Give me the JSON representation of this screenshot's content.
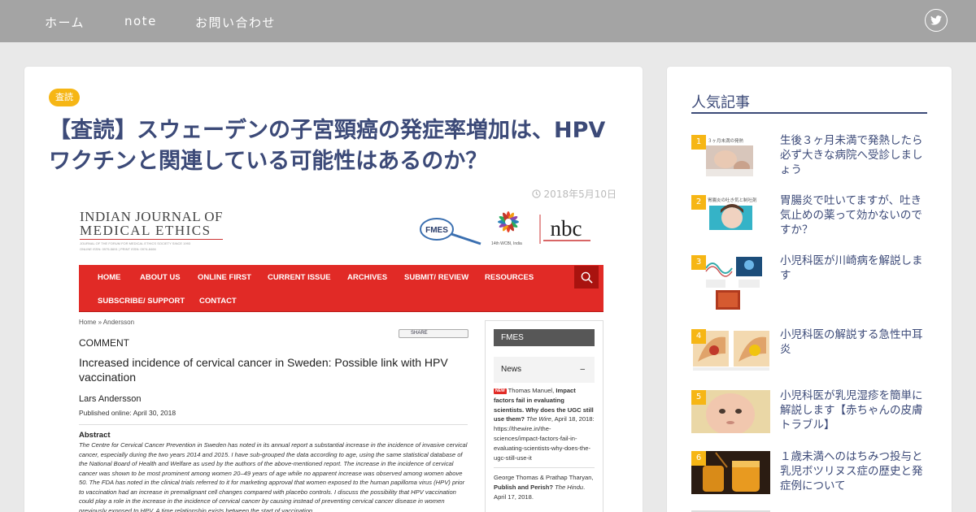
{
  "nav": {
    "items": [
      "ホーム",
      "note",
      "お問い合わせ"
    ]
  },
  "post": {
    "category": "査読",
    "title": "【査読】スウェーデンの子宮頸癌の発症率増加は、HPVワクチンと関連している可能性はあるのか？",
    "date": "2018年5月10日"
  },
  "screenshot": {
    "logo_line1": "INDIAN JOURNAL OF",
    "logo_line2": "MEDICAL ETHICS",
    "logo_sub": "JOURNAL OF THE FORUM FOR MEDICAL ETHICS SOCIETY SINCE 1993",
    "logo_issn": "ONLINE ISSN: 0975-5691 | PRINT ISSN: 0974-8466",
    "fmes_logo": "FMES",
    "wcbi_caption": "14th WCBI, India",
    "nbc_logo": "nbc",
    "menu": [
      "HOME",
      "ABOUT US",
      "ONLINE FIRST",
      "CURRENT ISSUE",
      "ARCHIVES",
      "SUBMIT/ REVIEW",
      "RESOURCES",
      "SUBSCRIBE/ SUPPORT",
      "CONTACT"
    ],
    "breadcrumb": "Home » Andersson",
    "share_label": "SHARE",
    "section_label": "COMMENT",
    "article_title": "Increased incidence of cervical cancer in Sweden: Possible link with HPV vaccination",
    "author": "Lars Andersson",
    "published": "Published online: April 30, 2018",
    "abstract_heading": "Abstract",
    "abstract_text": "The Centre for Cervical Cancer Prevention in Sweden has noted in its annual report a substantial increase in the incidence of invasive cervical cancer, especially during the two years 2014 and 2015. I have sub-grouped the data according to age, using the same statistical database of the National Board of Health and Welfare as used by the authors of the above-mentioned report. The increase in the incidence of cervical cancer was shown to be most prominent among women 20–49 years of age while no apparent increase was observed among women above 50. The FDA has noted in the clinical trials referred to it for marketing approval that women exposed to the human papilloma virus (HPV) prior to vaccination had an increase in premalignant cell changes compared with placebo controls. I discuss the possibility that HPV vaccination could play a role in the increase in the incidence of cervical cancer by causing instead of preventing cervical cancer disease in women previously exposed to HPV. A time relationship exists between the start of vaccination",
    "side_header": "FMES",
    "news_label": "News",
    "news_toggle": "–",
    "news1": {
      "badge": "NEW",
      "author": "Thomas Manuel, ",
      "title": "Impact factors fail in evaluating scientists. Why does the UGC still use them?",
      "source": " The Wire",
      "date": ", April 18, 2018: https://thewire.in/the-sciences/impact-factors-fail-in-evaluating-scientists-why-does-the-ugc-still-use-it"
    },
    "news2": {
      "author": "George Thomas & Prathap Tharyan, ",
      "title": "Publish and Perish?",
      "source": " The Hindu",
      "date": ". April 17, 2018."
    }
  },
  "sidebar": {
    "title": "人気記事",
    "items": [
      {
        "rank": "1",
        "title": "生後３ヶ月未満で発熱したら必ず大きな病院へ受診しましょう",
        "thumb_caption": "３ヶ月未満の発熱"
      },
      {
        "rank": "2",
        "title": "胃腸炎で吐いてますが、吐き気止めの薬って効かないのですか？",
        "thumb_caption": "胃腸炎の吐き気と制吐剤"
      },
      {
        "rank": "3",
        "title": "小児科医が川崎病を解説します"
      },
      {
        "rank": "4",
        "title": "小児科医の解説する急性中耳炎"
      },
      {
        "rank": "5",
        "title": "小児科医が乳児湿疹を簡単に解説します【赤ちゃんの皮膚トラブル】"
      },
      {
        "rank": "6",
        "title": "１歳未満へのはちみつ投与と乳児ボツリヌス症の歴史と発症例について"
      }
    ]
  },
  "colors": {
    "accent": "#f6b615",
    "title": "#3c4a78",
    "header": "#a4a4a4",
    "journal_red": "#e12a26"
  }
}
